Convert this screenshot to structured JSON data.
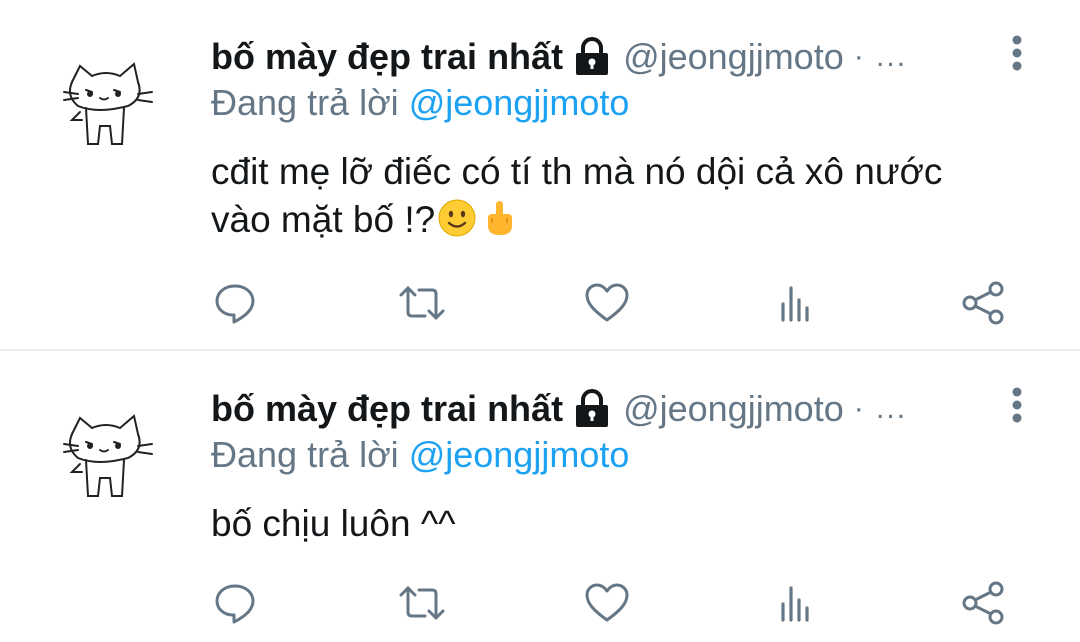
{
  "tweets": [
    {
      "display_name": "bố mày đẹp trai nhất",
      "handle": "@jeongjjmoto",
      "separator": "· ...",
      "replying_prefix": "Đang trả lời",
      "replying_to": "@jeongjjmoto",
      "text_line1": "cđit mẹ lỡ điếc có tí th mà nó dội cả xô nước",
      "text_line2": "vào mặt bố !?",
      "emojis": [
        "slightly-smiling-face-emoji",
        "middle-finger-emoji"
      ]
    },
    {
      "display_name": "bố mày đẹp trai nhất",
      "handle": "@jeongjjmoto",
      "separator": "· ...",
      "replying_prefix": "Đang trả lời",
      "replying_to": "@jeongjjmoto",
      "text_line1": "bố chịu luôn ^^"
    }
  ],
  "actions": [
    "reply-icon",
    "retweet-icon",
    "like-icon",
    "analytics-icon",
    "share-icon"
  ],
  "colors": {
    "text": "#14171a",
    "secondary": "#657786",
    "link": "#1da1f2",
    "divider": "#e6ecf0"
  }
}
